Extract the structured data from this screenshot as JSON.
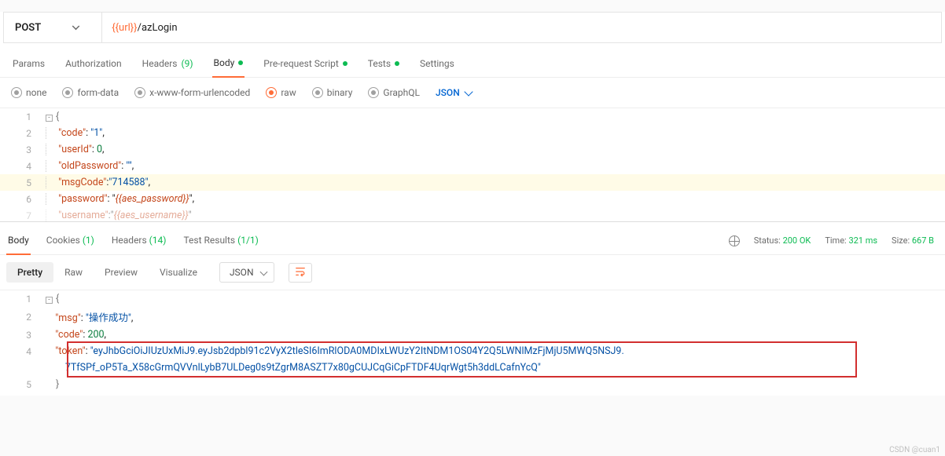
{
  "request": {
    "method": "POST",
    "url_var": "{{url}}",
    "url_suffix": "/azLogin"
  },
  "tabs": {
    "params": "Params",
    "auth": "Authorization",
    "headers": "Headers",
    "headers_count": "(9)",
    "body": "Body",
    "prs": "Pre-request Script",
    "tests": "Tests",
    "settings": "Settings"
  },
  "body_types": {
    "none": "none",
    "formdata": "form-data",
    "xwww": "x-www-form-urlencoded",
    "raw": "raw",
    "binary": "binary",
    "graphql": "GraphQL",
    "json": "JSON"
  },
  "request_body_lines": [
    {
      "n": "1",
      "raw": "{"
    },
    {
      "n": "2",
      "raw": "    \"code\": \"1\","
    },
    {
      "n": "3",
      "raw": "    \"userId\": 0,"
    },
    {
      "n": "4",
      "raw": "    \"oldPassword\": \"\","
    },
    {
      "n": "5",
      "raw": "    \"msgCode\":\"714588\","
    },
    {
      "n": "6",
      "raw": "    \"password\": \"{{aes_password}}\","
    },
    {
      "n": "7",
      "raw": "    \"username\":\"{{aes_username}}\""
    }
  ],
  "resp_tabs": {
    "body": "Body",
    "cookies": "Cookies",
    "cookies_count": "(1)",
    "headers": "Headers",
    "headers_count": "(14)",
    "tests_label": "Test Results",
    "tests_count": "(1/1)"
  },
  "resp_status": {
    "status_label": "Status:",
    "status_val": "200 OK",
    "time_label": "Time:",
    "time_val": "321 ms",
    "size_label": "Size:",
    "size_val": "667 B"
  },
  "resp_views": {
    "pretty": "Pretty",
    "raw": "Raw",
    "preview": "Preview",
    "visualize": "Visualize",
    "fmt": "JSON"
  },
  "response_lines": {
    "l1": "{",
    "l2_key": "\"msg\"",
    "l2_val": "\"操作成功\"",
    "l3_key": "\"code\"",
    "l3_val": "200",
    "l4_key": "\"token\"",
    "l4_val_a": "\"eyJhbGciOiJIUzUxMiJ9.eyJsb2dpbl91c2VyX2tleSI6ImRlODA0MDIxLWUzY2ItNDM1OS04Y2Q5LWNlMzFjMjU5MWQ5NSJ9.",
    "l4_val_b": "7TfSPf_oP5Ta_X58cGrmQVVnlLybB7ULDeg0s9tZgrM8ASZT7x80gCUJCqGiCpFTDF4UqrWgt5h3ddLCafnYcQ\"",
    "l5": "}"
  },
  "watermark": "CSDN @cuan1"
}
